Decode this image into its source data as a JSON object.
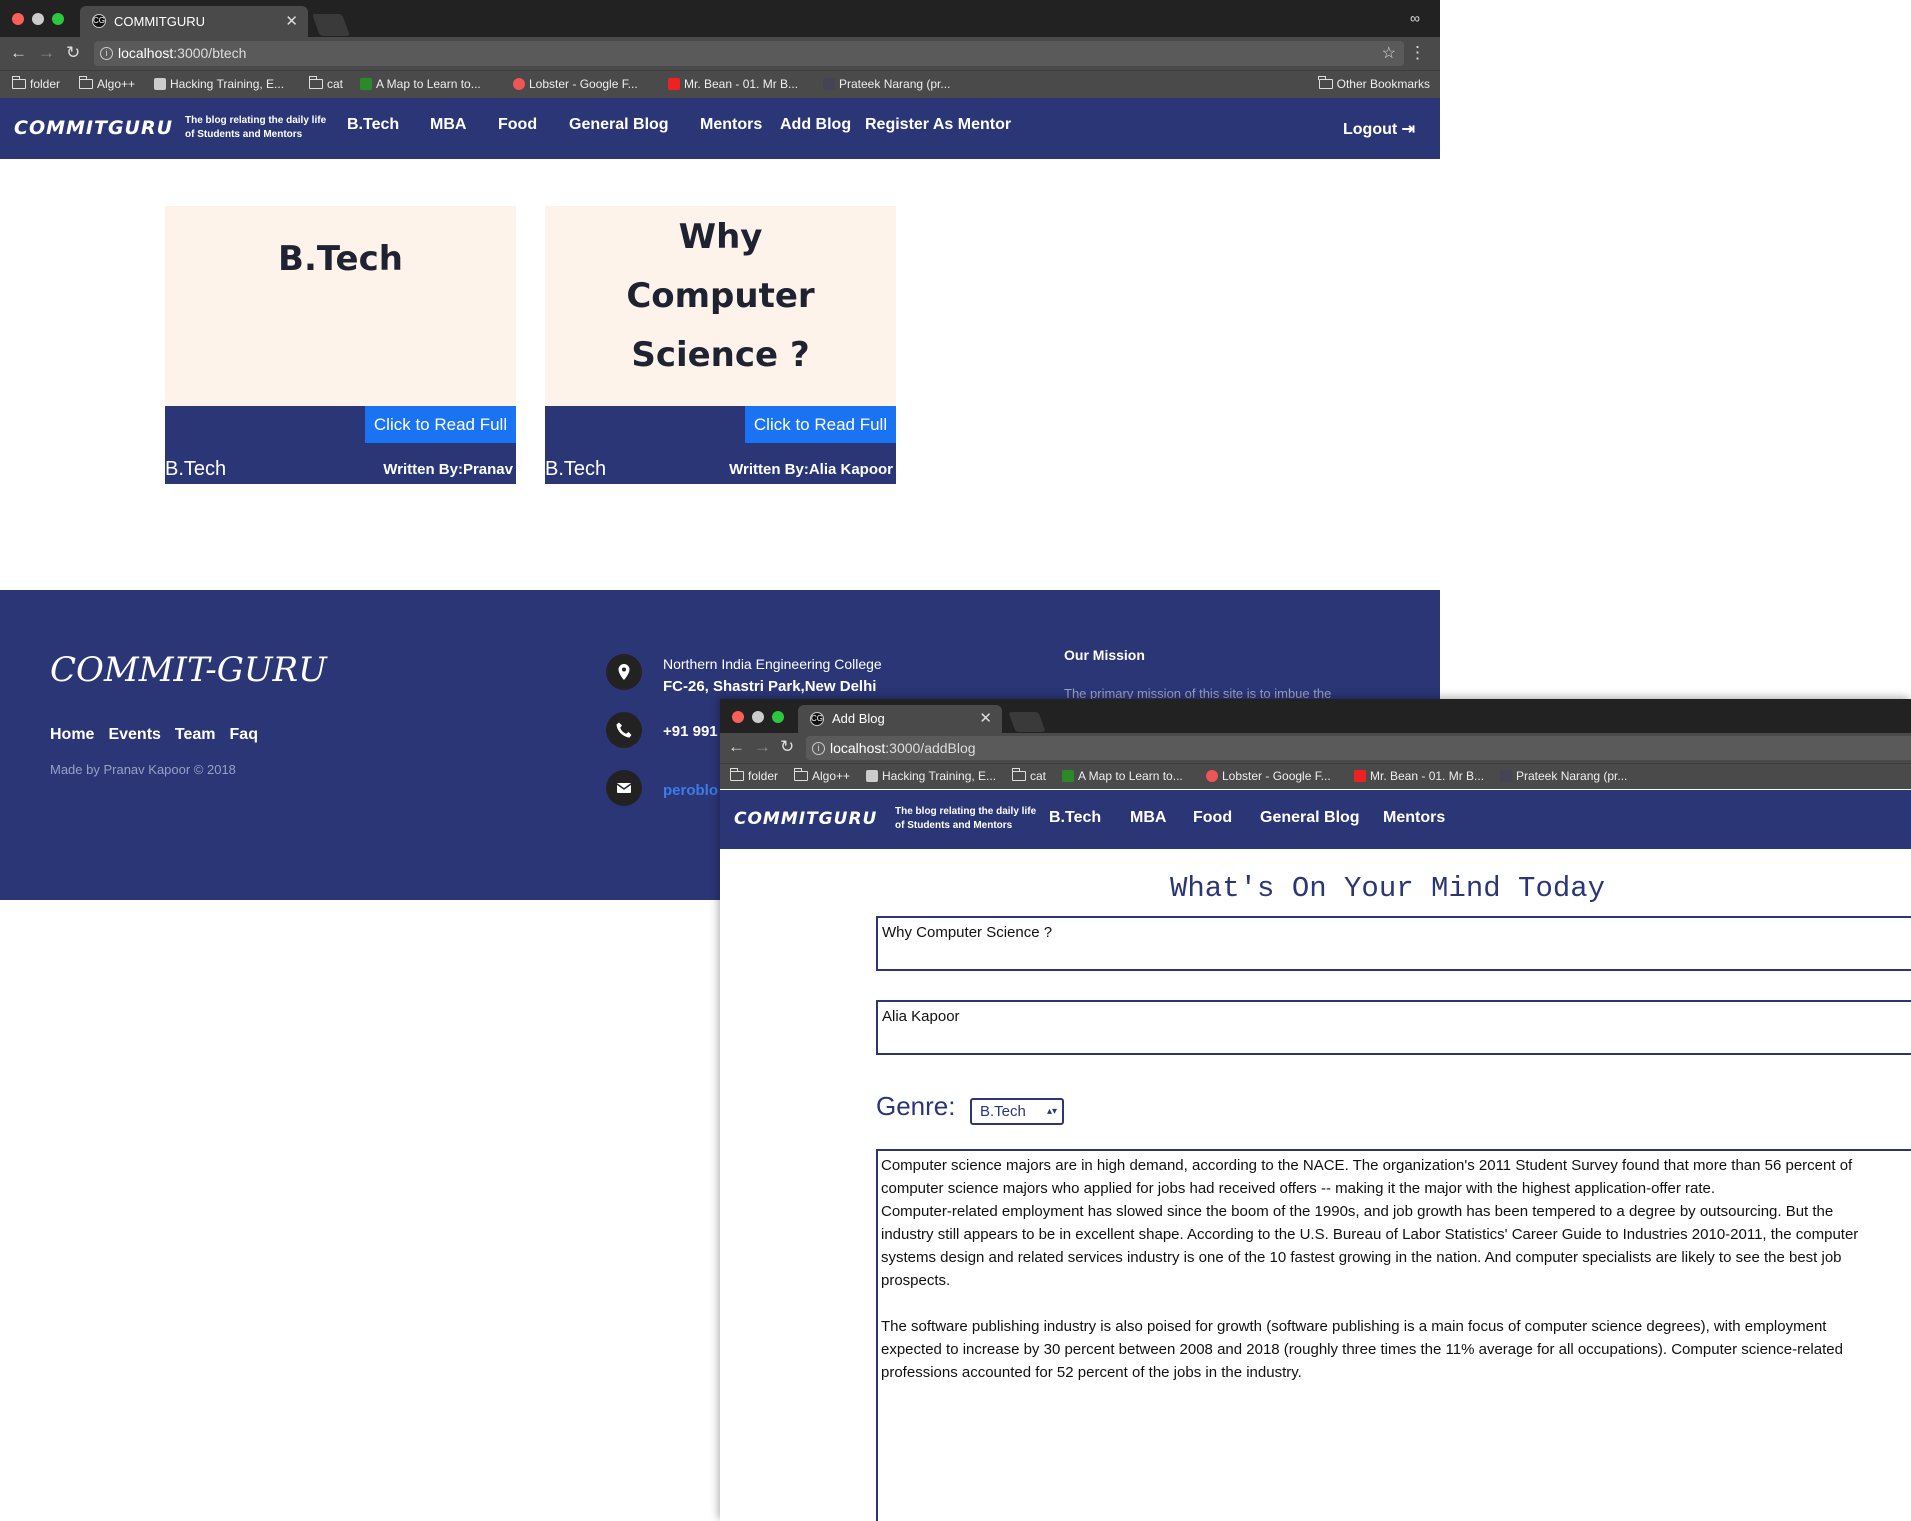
{
  "win1": {
    "tab_title": "COMMITGURU",
    "url_host": "localhost",
    "url_path": ":3000/btech",
    "bookmarks": [
      "folder",
      "Algo++",
      "Hacking Training, E...",
      "cat",
      "A Map to Learn to...",
      "Lobster - Google F...",
      "Mr. Bean - 01. Mr B...",
      "Prateek Narang (pr..."
    ],
    "other_bookmarks": "Other Bookmarks"
  },
  "site": {
    "logo": "COMMITGURU",
    "tagline_1": "The blog relating the daily life",
    "tagline_2": "of Students and Mentors",
    "nav": [
      "B.Tech",
      "MBA",
      "Food",
      "General Blog",
      "Mentors",
      "Add Blog",
      "Register As Mentor"
    ],
    "logout": "Logout"
  },
  "cards": [
    {
      "title_lines": [
        "B.Tech"
      ],
      "button": "Click to Read Full",
      "genre": "B.Tech",
      "author": "Written By:Pranav"
    },
    {
      "title_lines": [
        "Why",
        "Computer",
        "Science ?"
      ],
      "button": "Click to Read Full",
      "genre": "B.Tech",
      "author": "Written By:Alia Kapoor"
    }
  ],
  "footer": {
    "brand": "COMMIT-GURU",
    "links": [
      "Home",
      "Events",
      "Team",
      "Faq"
    ],
    "made_by": "Made by Pranav Kapoor © 2018",
    "address_1": "Northern India Engineering College",
    "address_2": "FC-26, Shastri Park,New Delhi",
    "phone": "+91 991",
    "email": "peroblo",
    "mission_title": "Our Mission",
    "mission_text": "The primary mission of this site is to imbue the"
  },
  "win2": {
    "tab_title": "Add Blog",
    "url_host": "localhost",
    "url_path": ":3000/addBlog",
    "bookmarks": [
      "folder",
      "Algo++",
      "Hacking Training, E...",
      "cat",
      "A Map to Learn to...",
      "Lobster - Google F...",
      "Mr. Bean - 01. Mr B...",
      "Prateek Narang (pr..."
    ],
    "nav": [
      "B.Tech",
      "MBA",
      "Food",
      "General Blog",
      "Mentors"
    ]
  },
  "form": {
    "heading": "What's On Your Mind Today",
    "title_value": "Why Computer Science ?",
    "author_value": "Alia Kapoor",
    "genre_label": "Genre:",
    "genre_selected": "B.Tech",
    "body": "Computer science majors are in high demand, according to the NACE. The organization's 2011 Student Survey found that more than 56 percent of\ncomputer science majors who applied for jobs had received offers -- making it the major with the highest application-offer rate.\nComputer-related employment has slowed since the boom of the 1990s, and job growth has been tempered to a degree by outsourcing. But the\nindustry still appears to be in excellent shape. According to the U.S. Bureau of Labor Statistics' Career Guide to Industries 2010-2011, the computer\nsystems design and related services industry is one of the 10 fastest growing in the nation. And computer specialists are likely to see the best job\nprospects.\n\nThe software publishing industry is also poised for growth (software publishing is a main focus of computer science degrees), with employment\nexpected to increase by 30 percent between 2008 and 2018 (roughly three times the 11% average for all occupations). Computer science-related\nprofessions accounted for 52 percent of the jobs in the industry."
  },
  "colors": {
    "navy": "#2b3677",
    "card_bg": "#fdf3ea",
    "button_blue": "#1a73f2",
    "chrome": "#4a4a4a"
  }
}
